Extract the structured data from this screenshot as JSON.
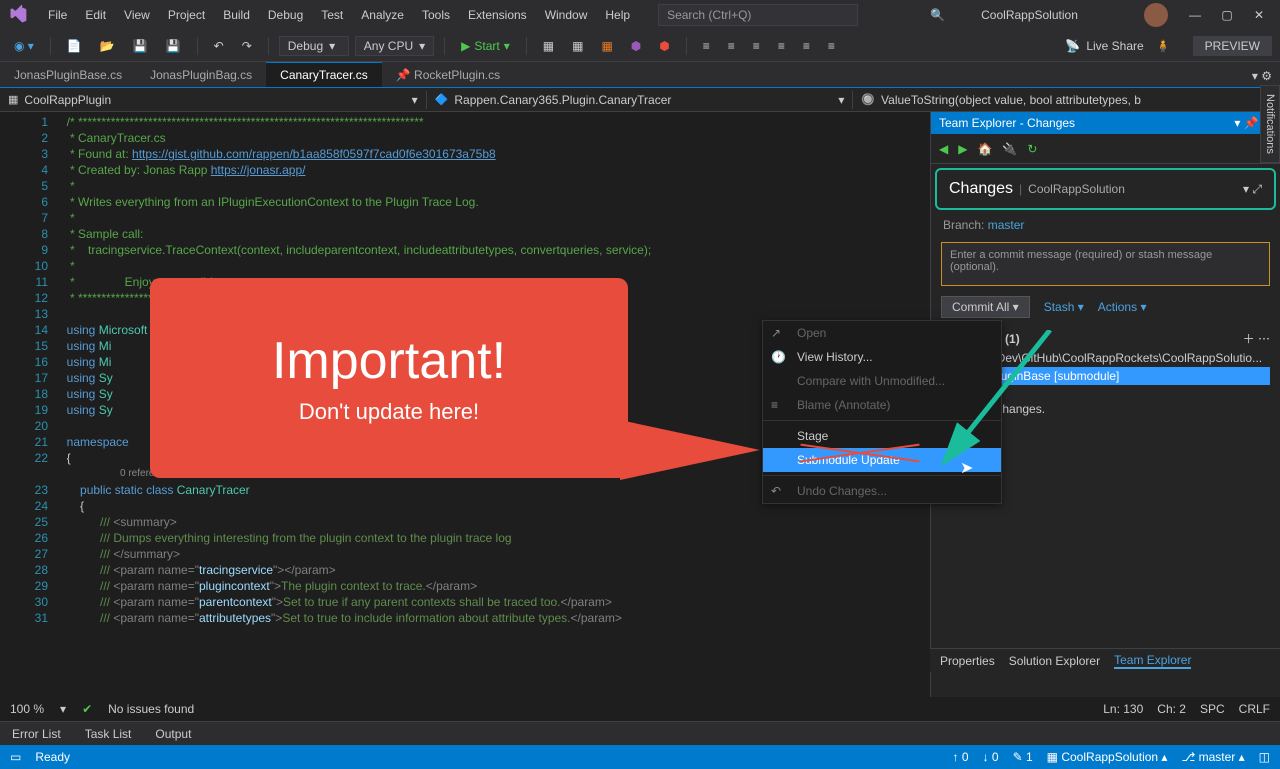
{
  "menubar": [
    "File",
    "Edit",
    "View",
    "Project",
    "Build",
    "Debug",
    "Test",
    "Analyze",
    "Tools",
    "Extensions",
    "Window",
    "Help"
  ],
  "search_placeholder": "Search (Ctrl+Q)",
  "solution_name": "CoolRappSolution",
  "toolbar": {
    "config": "Debug",
    "platform": "Any CPU",
    "start": "Start",
    "liveshare": "Live Share",
    "preview": "PREVIEW"
  },
  "tabs": [
    {
      "label": "JonasPluginBase.cs",
      "active": false
    },
    {
      "label": "JonasPluginBag.cs",
      "active": false
    },
    {
      "label": "CanaryTracer.cs",
      "active": true
    },
    {
      "label": "RocketPlugin.cs",
      "active": false,
      "pin": true
    }
  ],
  "nav": {
    "left": "CoolRappPlugin",
    "mid": "Rappen.Canary365.Plugin.CanaryTracer",
    "right": "ValueToString(object value, bool attributetypes, b"
  },
  "code_lines": [
    "/* **************************************************************************",
    " * CanaryTracer.cs",
    " * Found at: https://gist.github.com/rappen/b1aa858f0597f7cad0f6e301673a75b8",
    " * Created by: Jonas Rapp https://jonasr.app/",
    " *",
    " * Writes everything from an IPluginExecutionContext to the Plugin Trace Log.",
    " *",
    " * Sample call:",
    " *    tracingservice.TraceContext(context, includeparentcontext, includeattributetypes, convertqueries, service);",
    " *",
    " *               Enjoy responsibly.",
    " * **************************************************************************/",
    "",
    "using Microsoft",
    "using Mi",
    "using Mi",
    "using Sy",
    "using Sy",
    "using Sy",
    "",
    "namespace",
    "{",
    "",
    "    public static class CanaryTracer",
    "    {",
    "        /// <summary>",
    "        /// Dumps everything interesting from the plugin context to the plugin trace log",
    "        /// </summary>",
    "        /// <param name=\"tracingservice\"></param>",
    "        /// <param name=\"plugincontext\">The plugin context to trace.</param>",
    "        /// <param name=\"parentcontext\">Set to true if any parent contexts shall be traced too.</param>",
    "        /// <param name=\"attributetypes\">Set to true to include information about attribute types.</param>"
  ],
  "codelens": "0 references | 0 changes | 0 authors, 0 changes",
  "team_explorer": {
    "title": "Team Explorer - Changes",
    "heading": "Changes",
    "solution": "CoolRappSolution",
    "branch_label": "Branch:",
    "branch": "master",
    "commit_placeholder": "Enter a commit message (required) or stash message (optional).",
    "commit_all": "Commit All",
    "stash": "Stash",
    "actions": "Actions",
    "changes_header": "Changes (1)",
    "path": "C:\\Dev\\GitHub\\CoolRappRockets\\CoolRappSolutio...",
    "submodule": "PluginBase [submodule]",
    "stashes": "shed changes."
  },
  "context_menu": [
    {
      "label": "Open",
      "disabled": true,
      "icon": "↗"
    },
    {
      "label": "View History...",
      "icon": "🕐"
    },
    {
      "label": "Compare with Unmodified...",
      "disabled": true
    },
    {
      "label": "Blame (Annotate)",
      "disabled": true,
      "icon": "≡"
    },
    {
      "sep": true
    },
    {
      "label": "Stage"
    },
    {
      "label": "Submodule Update",
      "hover": true
    },
    {
      "sep": true
    },
    {
      "label": "Undo Changes...",
      "disabled": true,
      "icon": "↶"
    }
  ],
  "callout": {
    "title": "Important!",
    "sub": "Don't update here!"
  },
  "status_strip": {
    "zoom": "100 %",
    "issues": "No issues found",
    "ln": "Ln: 130",
    "ch": "Ch: 2",
    "spc": "SPC",
    "crlf": "CRLF"
  },
  "prop_tabs": [
    "Properties",
    "Solution Explorer",
    "Team Explorer"
  ],
  "bottom_tabs": [
    "Error List",
    "Task List",
    "Output"
  ],
  "statusbar": {
    "ready": "Ready",
    "up": "0",
    "down": "0",
    "pen": "1",
    "repo": "CoolRappSolution",
    "branch": "master"
  },
  "vtab": "Notifications"
}
